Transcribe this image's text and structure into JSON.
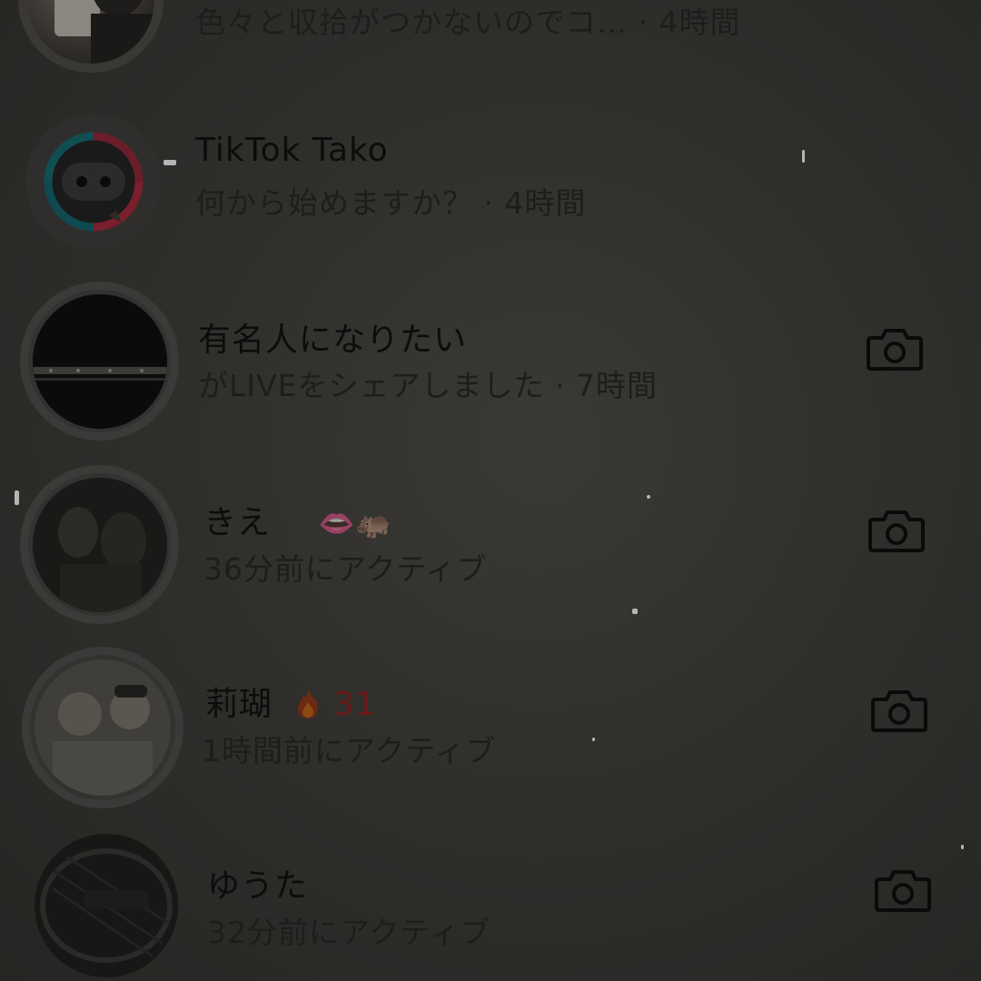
{
  "conversations": [
    {
      "id": "row-0",
      "name": "",
      "subtitle": "色々と収拾がつかないのでコ… · 4時間",
      "has_camera": false
    },
    {
      "id": "row-1",
      "name": "TikTok Tako",
      "subtitle": "何から始めますか？ · 4時間",
      "has_camera": false
    },
    {
      "id": "row-2",
      "name": "有名人になりたい",
      "subtitle": "がLIVEをシェアしました · 7時間",
      "has_camera": true
    },
    {
      "id": "row-3",
      "name": "きえ",
      "name_emoji": "👄🦛",
      "subtitle": "36分前にアクティブ",
      "has_camera": true
    },
    {
      "id": "row-4",
      "name": "莉瑚",
      "streak_icon": "fire-icon",
      "streak_count": "31",
      "subtitle": "1時間前にアクティブ",
      "has_camera": true
    },
    {
      "id": "row-5",
      "name": "ゆうた",
      "subtitle": "32分前にアクティブ",
      "has_camera": true
    }
  ],
  "colors": {
    "background": "#302f2c",
    "name_text": "#0c0c0c",
    "subtitle_text": "#1d1d1c",
    "streak": "#6a1a1a"
  }
}
